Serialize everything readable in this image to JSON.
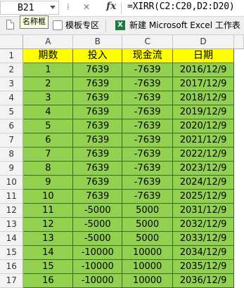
{
  "formula_bar": {
    "name_box": "B21",
    "fx": "fx",
    "formula": "=XIRR(C2:C20,D2:D20)"
  },
  "tabs_bar": {
    "tooltip": "名称框",
    "tabs": [
      {
        "label": "模板专区",
        "icon": "template-icon"
      },
      {
        "label": "新建 Microsoft Excel 工作表",
        "icon": "excel-icon"
      }
    ]
  },
  "sheet": {
    "columns": [
      "A",
      "B",
      "C",
      "D"
    ],
    "header_row": {
      "row": "1",
      "cells": [
        "期数",
        "投入",
        "现金流",
        "日期"
      ]
    },
    "rows": [
      {
        "row": "2",
        "cells": [
          "1",
          "7639",
          "-7639",
          "2016/12/9"
        ]
      },
      {
        "row": "3",
        "cells": [
          "2",
          "7639",
          "-7639",
          "2017/12/9"
        ]
      },
      {
        "row": "4",
        "cells": [
          "3",
          "7639",
          "-7639",
          "2018/12/9"
        ]
      },
      {
        "row": "5",
        "cells": [
          "4",
          "7639",
          "-7639",
          "2019/12/9"
        ]
      },
      {
        "row": "6",
        "cells": [
          "5",
          "7639",
          "-7639",
          "2020/12/9"
        ]
      },
      {
        "row": "7",
        "cells": [
          "6",
          "7639",
          "-7639",
          "2021/12/9"
        ]
      },
      {
        "row": "8",
        "cells": [
          "7",
          "7639",
          "-7639",
          "2022/12/9"
        ]
      },
      {
        "row": "9",
        "cells": [
          "8",
          "7639",
          "-7639",
          "2023/12/9"
        ]
      },
      {
        "row": "10",
        "cells": [
          "9",
          "7639",
          "-7639",
          "2024/12/9"
        ]
      },
      {
        "row": "11",
        "cells": [
          "10",
          "7639",
          "-7639",
          "2025/12/9"
        ]
      },
      {
        "row": "12",
        "cells": [
          "11",
          "-5000",
          "5000",
          "2031/12/9"
        ]
      },
      {
        "row": "13",
        "cells": [
          "12",
          "-5000",
          "5000",
          "2032/12/9"
        ]
      },
      {
        "row": "14",
        "cells": [
          "13",
          "-5000",
          "5000",
          "2033/12/9"
        ]
      },
      {
        "row": "15",
        "cells": [
          "14",
          "-10000",
          "10000",
          "2034/12/9"
        ]
      },
      {
        "row": "16",
        "cells": [
          "15",
          "-10000",
          "10000",
          "2035/12/9"
        ]
      },
      {
        "row": "17",
        "cells": [
          "16",
          "-10000",
          "10000",
          "2036/12/9"
        ]
      }
    ]
  },
  "colors": {
    "header_fill": "#ffff00",
    "data_fill": "#92d050"
  }
}
